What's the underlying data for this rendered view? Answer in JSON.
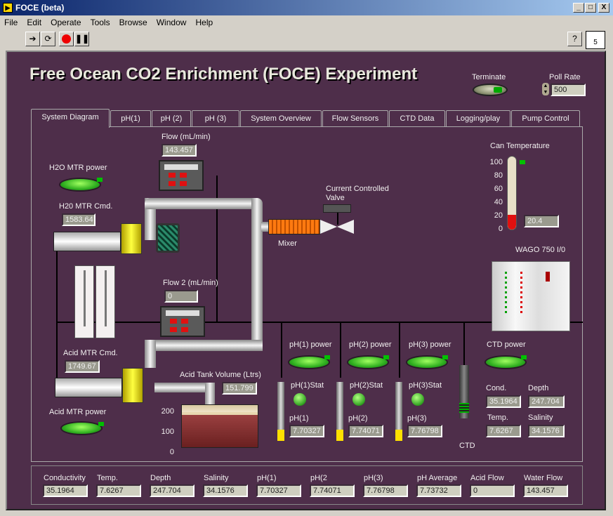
{
  "window": {
    "title": "FOCE (beta)",
    "min": "_",
    "max": "□",
    "close": "X"
  },
  "menu": [
    "File",
    "Edit",
    "Operate",
    "Tools",
    "Browse",
    "Window",
    "Help"
  ],
  "toolbar": {
    "help": "?",
    "vi_badge": "5"
  },
  "header": {
    "title": "Free Ocean CO2 Enrichment (FOCE) Experiment",
    "terminate_label": "Terminate",
    "poll_rate_label": "Poll Rate",
    "poll_rate_value": "500"
  },
  "tabs": [
    "System Diagram",
    "pH(1)",
    "pH (2)",
    "pH (3)",
    "System Overview",
    "Flow Sensors",
    "CTD Data",
    "Logging/play",
    "Pump Control"
  ],
  "diagram": {
    "flow_label": "Flow (mL/min)",
    "flow_value": "143.457",
    "h2o_power_label": "H2O MTR power",
    "h2o_cmd_label": "H20 MTR Cmd.",
    "h2o_cmd_value": "1583.64",
    "ccv_label_1": "Current Controlled",
    "ccv_label_2": "Valve",
    "mixer_label": "Mixer",
    "can_temp_label": "Can Temperature",
    "can_temp_value": "20.4",
    "can_temp_scale": [
      "100",
      "80",
      "60",
      "40",
      "20",
      "0"
    ],
    "wago_label": "WAGO 750 I/0",
    "flow2_label": "Flow 2 (mL/min)",
    "flow2_value": "0",
    "acid_cmd_label": "Acid MTR Cmd.",
    "acid_cmd_value": "1749.67",
    "acid_power_label": "Acid MTR power",
    "acid_tank_label": "Acid Tank Volume (Ltrs)",
    "acid_tank_value": "151.799",
    "tank_scale": [
      "200",
      "100",
      "0"
    ],
    "ph1_power": "pH(1) power",
    "ph2_power": "pH(2) power",
    "ph3_power": "pH(3) power",
    "ctd_power": "CTD power",
    "ph1_stat": "pH(1)Stat",
    "ph2_stat": "pH(2)Stat",
    "ph3_stat": "pH(3)Stat",
    "ph1_label": "pH(1)",
    "ph1_value": "7.70327",
    "ph2_label": "pH(2)",
    "ph2_value": "7.74071",
    "ph3_label": "pH(3)",
    "ph3_value": "7.76798",
    "ctd_label": "CTD",
    "cond_label": "Cond.",
    "cond_value": "35.1964",
    "depth_label": "Depth",
    "depth_value": "247.704",
    "temp_label": "Temp.",
    "temp_value": "7.6267",
    "salinity_label": "Salinity",
    "salinity_value": "34.1576"
  },
  "summary": [
    {
      "label": "Conductivity",
      "value": "35.1964"
    },
    {
      "label": "Temp.",
      "value": "7.6267"
    },
    {
      "label": "Depth",
      "value": "247.704"
    },
    {
      "label": "Salinity",
      "value": "34.1576"
    },
    {
      "label": "pH(1)",
      "value": "7.70327"
    },
    {
      "label": "pH(2",
      "value": "7.74071"
    },
    {
      "label": "pH(3)",
      "value": "7.76798"
    },
    {
      "label": "pH Average",
      "value": "7.73732"
    },
    {
      "label": "Acid Flow",
      "value": "0"
    },
    {
      "label": "Water Flow",
      "value": "143.457"
    }
  ]
}
